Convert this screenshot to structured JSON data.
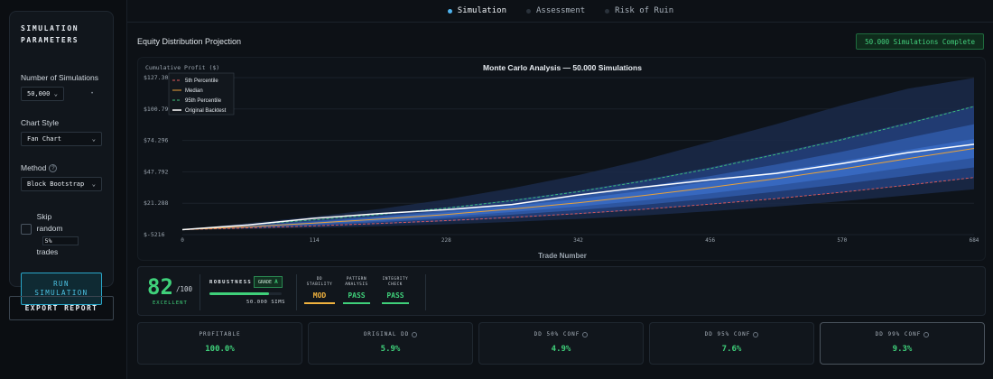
{
  "sidebar": {
    "title_line1": "SIMULATION",
    "title_line2": "PARAMETERS",
    "num_sims_label": "Number of Simulations",
    "num_sims_value": "50,000",
    "chart_style_label": "Chart Style",
    "chart_style_value": "Fan Chart",
    "method_label": "Method",
    "method_value": "Block Bootstrap",
    "skip_line1": "Skip",
    "skip_line2": "random",
    "skip_line3": "trades",
    "skip_pct": "5%",
    "run_line1": "RUN",
    "run_line2": "SIMULATION",
    "export_label": "EXPORT REPORT"
  },
  "tabs": [
    {
      "label": "Simulation",
      "active": true
    },
    {
      "label": "Assessment",
      "active": false
    },
    {
      "label": "Risk of Ruin",
      "active": false
    }
  ],
  "header": {
    "title": "Equity Distribution Projection",
    "badge": "50.000 Simulations Complete"
  },
  "chart_data": {
    "type": "area",
    "title": "Monte Carlo Analysis — 50.000 Simulations",
    "ylabel": "Cumulative Profit ($)",
    "xlabel": "Trade Number",
    "yticks": [
      "$-5216",
      "$21.288",
      "$47.792",
      "$74.296",
      "$100.799",
      "$127.303"
    ],
    "xticks": [
      "0",
      "114",
      "228",
      "342",
      "456",
      "570",
      "684"
    ],
    "xlim": [
      0,
      684
    ],
    "ylim": [
      -5216,
      127303
    ],
    "legend": [
      "5th Percentile",
      "Median",
      "95th Percentile",
      "Original Backtest"
    ],
    "legend_position": "top-left",
    "colors": {
      "p5": "#e05a5a",
      "median": "#e9a23b",
      "p95": "#3fc47a",
      "original": "#ffffff",
      "band_outer": "#1a2a4a",
      "band_mid": "#23407a",
      "band_inner": "#2f5aa8"
    },
    "x": [
      0,
      57,
      114,
      171,
      228,
      285,
      342,
      399,
      456,
      513,
      570,
      627,
      684
    ],
    "series": [
      {
        "name": "5th Percentile",
        "values": [
          -1000,
          400,
          2200,
          4200,
          6600,
          9300,
          12500,
          16200,
          20500,
          25200,
          30600,
          36600,
          43000
        ]
      },
      {
        "name": "Median",
        "values": [
          -1000,
          1500,
          4500,
          7900,
          11800,
          16400,
          21700,
          27800,
          34600,
          42000,
          50200,
          59000,
          67500
        ]
      },
      {
        "name": "95th Percentile",
        "values": [
          -1000,
          3000,
          7200,
          11800,
          17200,
          23500,
          31000,
          40000,
          50500,
          62500,
          75000,
          88500,
          103000
        ]
      },
      {
        "name": "Original Backtest",
        "values": [
          -1000,
          3000,
          8600,
          12600,
          15800,
          20200,
          28200,
          35000,
          41000,
          46500,
          54800,
          64000,
          71000
        ]
      }
    ],
    "bands": [
      {
        "lower": [
          -1000,
          -500,
          500,
          1800,
          3500,
          5500,
          8000,
          11000,
          14500,
          18500,
          23000,
          28000,
          33000
        ],
        "upper": [
          -1000,
          4500,
          10000,
          16500,
          24500,
          34000,
          45000,
          58000,
          73000,
          88000,
          104000,
          118000,
          127000
        ]
      },
      {
        "lower": [
          -1000,
          200,
          1700,
          3600,
          6000,
          8800,
          12000,
          15800,
          20200,
          25000,
          30400,
          36400,
          42500
        ],
        "upper": [
          -1000,
          3100,
          7400,
          12200,
          17800,
          24200,
          31800,
          41000,
          51500,
          63500,
          76000,
          89500,
          103500
        ]
      },
      {
        "lower": [
          -1000,
          700,
          2800,
          5200,
          8200,
          11600,
          15500,
          20000,
          25200,
          31000,
          37400,
          44500,
          51500
        ],
        "upper": [
          -1000,
          2400,
          6200,
          10400,
          15200,
          20800,
          27500,
          35300,
          44200,
          54000,
          64800,
          76500,
          88000
        ]
      },
      {
        "lower": [
          -1000,
          1100,
          3600,
          6500,
          9900,
          13900,
          18500,
          23700,
          29700,
          36300,
          43700,
          51800,
          59500
        ],
        "upper": [
          -1000,
          1900,
          5400,
          9300,
          13700,
          18900,
          24900,
          31900,
          39500,
          47800,
          56800,
          66300,
          75500
        ]
      }
    ]
  },
  "score": {
    "value": "82",
    "max": "/100",
    "label": "EXCELLENT",
    "robustness_label": "ROBUSTNESS",
    "grade_label": "GRADE",
    "grade_value": "A",
    "robustness_fraction": 0.82,
    "sims": "50.000 SIMS",
    "metrics": [
      {
        "label1": "DD",
        "label2": "STABILITY",
        "value": "MOD",
        "status": "mod"
      },
      {
        "label1": "PATTERN",
        "label2": "ANALYSIS",
        "value": "PASS",
        "status": "pass"
      },
      {
        "label1": "INTEGRITY",
        "label2": "CHECK",
        "value": "PASS",
        "status": "pass"
      }
    ]
  },
  "stats": [
    {
      "label": "PROFITABLE",
      "value": "100.0%",
      "info": false
    },
    {
      "label": "ORIGINAL DD",
      "value": "5.9%",
      "info": true
    },
    {
      "label": "DD 50% CONF",
      "value": "4.9%",
      "info": true
    },
    {
      "label": "DD 95% CONF",
      "value": "7.6%",
      "info": true
    },
    {
      "label": "DD 99% CONF",
      "value": "9.3%",
      "info": true
    }
  ]
}
